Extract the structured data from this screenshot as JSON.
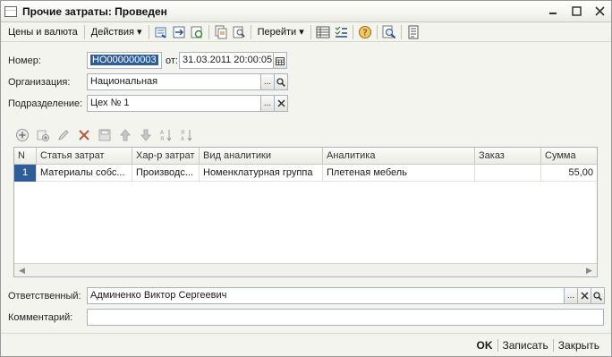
{
  "window": {
    "title": "Прочие затраты: Проведен"
  },
  "toolbar": {
    "prices_label": "Цены и валюта",
    "actions_label": "Действия",
    "goto_label": "Перейти"
  },
  "form": {
    "number_label": "Номер:",
    "number_value": "НО000000003",
    "date_from_label": "от:",
    "date_value": "31.03.2011 20:00:05",
    "org_label": "Организация:",
    "org_value": "Национальная",
    "dept_label": "Подразделение:",
    "dept_value": "Цех № 1",
    "responsible_label": "Ответственный:",
    "responsible_value": "Админенко Виктор Сергеевич",
    "comment_label": "Комментарий:",
    "comment_value": ""
  },
  "table": {
    "columns": [
      "N",
      "Статья затрат",
      "Хар-р затрат",
      "Вид аналитики",
      "Аналитика",
      "Заказ",
      "Сумма"
    ],
    "rows": [
      [
        "1",
        "Материалы собс...",
        "Производс...",
        "Номенклатурная группа",
        "Плетеная мебель",
        "",
        "55,00"
      ]
    ]
  },
  "bottom": {
    "ok_label": "OK",
    "save_label": "Записать",
    "close_label": "Закрыть"
  }
}
